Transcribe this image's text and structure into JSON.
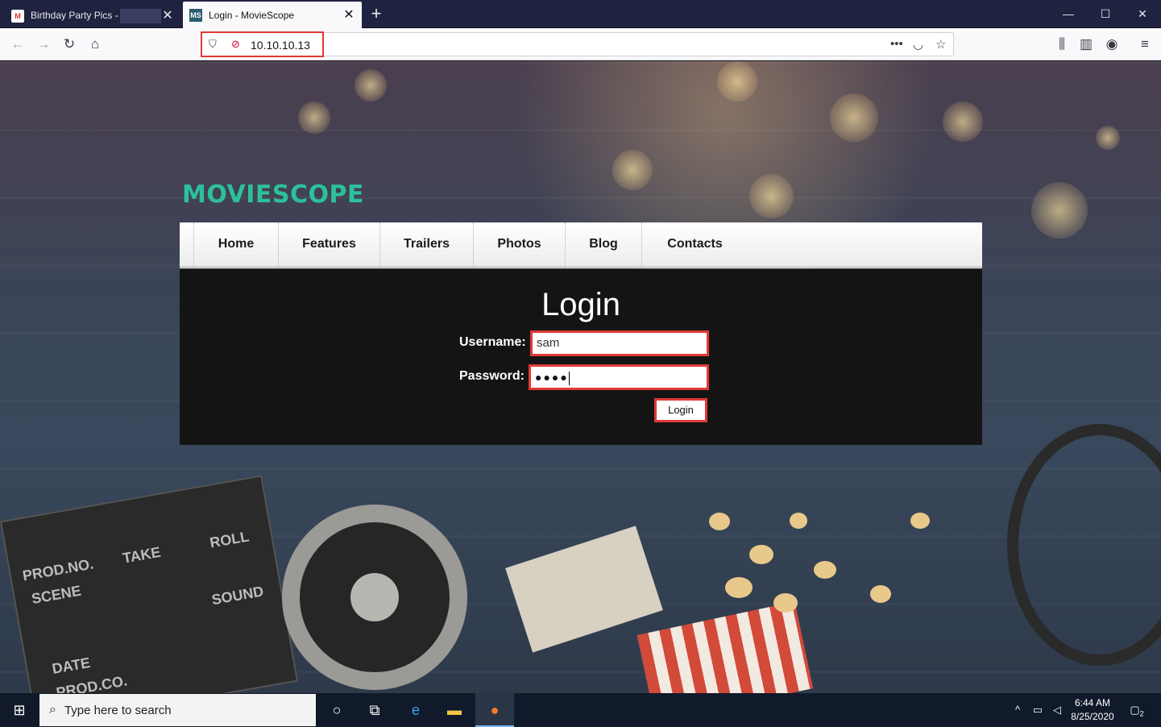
{
  "browser": {
    "tabs": [
      {
        "title": "Birthday Party Pics -",
        "favicon": "gmail-icon"
      },
      {
        "title": "Login - MovieScope",
        "favicon": "MS"
      }
    ],
    "url": "10.10.10.13",
    "window_controls": {
      "minimize": "—",
      "maximize": "☐",
      "close": "✕"
    }
  },
  "site": {
    "logo": "MOVIESCOPE",
    "menu": [
      "Home",
      "Features",
      "Trailers",
      "Photos",
      "Blog",
      "Contacts"
    ],
    "login": {
      "title": "Login",
      "username_label": "Username:",
      "username_value": "sam",
      "password_label": "Password:",
      "password_value": "●●●●",
      "button": "Login"
    }
  },
  "taskbar": {
    "search_placeholder": "Type here to search",
    "time": "6:44 AM",
    "date": "8/25/2020",
    "notifications": "2"
  },
  "colors": {
    "logo": "#2cc09b",
    "highlight": "#e03a34",
    "panel": "#141414"
  }
}
